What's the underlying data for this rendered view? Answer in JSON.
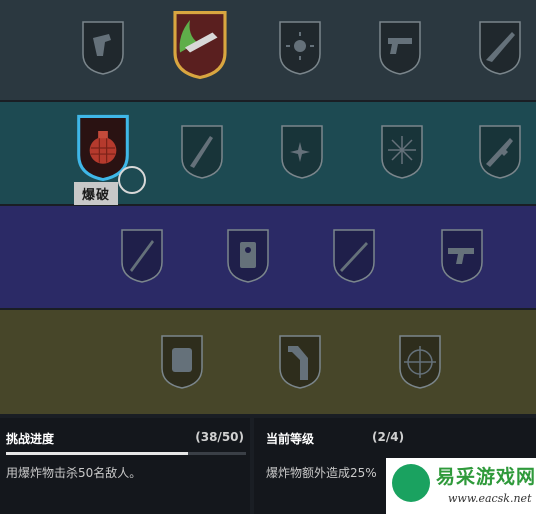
{
  "badges": {
    "row1": [
      "pistol-hand-icon",
      "knife-flame-icon",
      "sun-icon",
      "handgun-icon",
      "shotgun-icon"
    ],
    "row2": [
      "grenade-icon",
      "blade-icon",
      "sparkle-icon",
      "burst-icon",
      "rifle-icon"
    ],
    "row3": [
      "staff-icon",
      "radio-icon",
      "sniper-icon",
      "revolver-icon"
    ],
    "row4": [
      "tiger-icon",
      "armor-icon",
      "crosshair-icon"
    ]
  },
  "selected_label": "爆破",
  "progress_panel": {
    "title": "挑战进度",
    "value": "(38/50)",
    "current": 38,
    "total": 50,
    "desc": "用爆炸物击杀50名敌人。"
  },
  "level_panel": {
    "title": "当前等级",
    "value": "(2/4)",
    "desc": "爆炸物额外造成25%"
  },
  "watermark": {
    "title": "易采游戏网",
    "url": "www.eacsk.net"
  },
  "colors": {
    "row1": "#2b3840",
    "row2": "#1d4a52",
    "row3": "#2b2a66",
    "row4": "#474629",
    "selected_border": "#3fb7e8",
    "unlocked_border": "#d9a640"
  }
}
